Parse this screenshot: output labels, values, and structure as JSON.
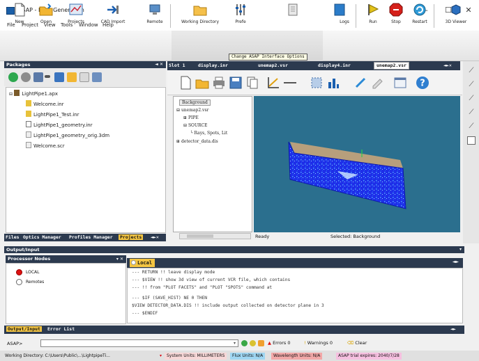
{
  "window": {
    "title": "ASAP - Next Generation",
    "minimize": "–",
    "maximize": "☐",
    "close": "✕"
  },
  "menu": [
    "File",
    "Project",
    "View",
    "Tools",
    "Window",
    "Help"
  ],
  "toolbar": {
    "buttons": [
      {
        "label": "New",
        "icon": "new-file-icon"
      },
      {
        "label": "Open",
        "icon": "open-folder-icon"
      },
      {
        "label": "Projects",
        "icon": "projects-icon"
      },
      {
        "label": "CAD Import",
        "icon": "cad-import-icon"
      },
      {
        "label": "Remote",
        "icon": "remote-icon"
      },
      {
        "label": "Working Directory",
        "icon": "working-directory-icon"
      },
      {
        "label": "Prefe",
        "icon": "preferences-icon"
      },
      {
        "label": "Logs",
        "icon": "logs-icon"
      },
      {
        "label": "Run",
        "icon": "run-icon"
      },
      {
        "label": "Stop",
        "icon": "stop-icon"
      },
      {
        "label": "Restart",
        "icon": "restart-icon"
      },
      {
        "label": "3D Viewer",
        "icon": "3d-viewer-icon"
      }
    ],
    "tooltip": "Change ASAP Interface Options"
  },
  "packages": {
    "title": "Packages",
    "project": "LightPipe1.apx",
    "files": [
      "Welcome.inr",
      "LightPipe1_Test.inr",
      "LightPipe1_geometry.inr",
      "LightPipe1_geometry_orig.3dm",
      "Welcome.scr"
    ],
    "tabs": [
      "Files",
      "Optics Manager",
      "Profiles Manager",
      "Projects"
    ]
  },
  "doc_tabs": [
    "Slot 1",
    "display.inr",
    "unemap2.vsr",
    "display4.inr",
    "unemap2.vsr"
  ],
  "structure_tree": {
    "header": "Background",
    "items": [
      "unemap2.vsr",
      "PIPE",
      "SOURCE",
      "Rays, Spots, Lit",
      "detector_data.dis"
    ]
  },
  "view": {
    "status_ready": "Ready",
    "status_selected": "Selected: Background"
  },
  "output": {
    "title": "Output/Input",
    "processor_header": "Processor Nodes",
    "nodes": [
      {
        "label": "LOCAL",
        "selected": true
      },
      {
        "label": "Remotes",
        "selected": false
      }
    ],
    "local_tab": "Local",
    "script_lines": [
      "--- RETURN                          !! leave display mode",
      "--- $VIEW                           !! show 3d view of current VCR file, which contains",
      "---                                 !! from \"PLOT FACETS\" and \"PLOT \"SPOTS\" command at",
      "--- $IF (SAVE_HIST) NE 0 THEN",
      "      $VIEW DETECTOR_DATA.DIS       !! include output collected on detector plane in 3",
      "--- $ENDIF"
    ],
    "bottom_tabs": [
      "Output/Input",
      "Error List"
    ]
  },
  "command": {
    "prompt": "ASAP>",
    "errors": "Errors 0",
    "warnings": "Warnings 0",
    "clear": "Clear"
  },
  "statusbar": {
    "working_directory": "Working Directory:   C:\\Users\\Public\\...\\LightpipeTi...",
    "system_units": "System Units: MILLIMETERS",
    "flux_units": "Flux Units: N/A",
    "wavelength_units": "Wavelength Units: N/A",
    "license": "ASAP trial expires: 2040/7/28"
  },
  "colors": {
    "panel_dark": "#2c3a4f",
    "active_tab": "#f4c542",
    "viewport": "#2b6f8e",
    "detector": "#1e2fe8"
  }
}
